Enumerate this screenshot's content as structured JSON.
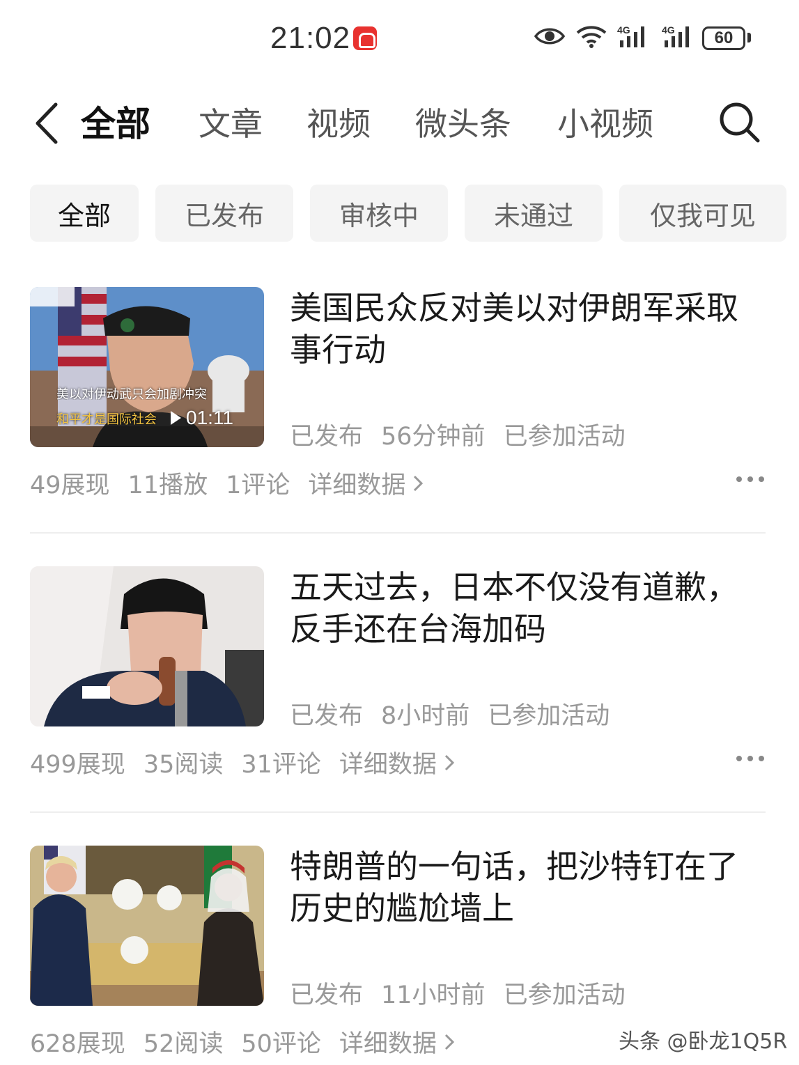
{
  "status_bar": {
    "time": "21:02",
    "network1": "4G",
    "network2": "4G",
    "battery": "60"
  },
  "top_nav": {
    "tabs": [
      {
        "label": "全部",
        "active": true
      },
      {
        "label": "文章",
        "active": false
      },
      {
        "label": "视频",
        "active": false
      },
      {
        "label": "微头条",
        "active": false
      },
      {
        "label": "小视频",
        "active": false
      }
    ]
  },
  "filters": [
    {
      "label": "全部",
      "active": true
    },
    {
      "label": "已发布",
      "active": false
    },
    {
      "label": "审核中",
      "active": false
    },
    {
      "label": "未通过",
      "active": false
    },
    {
      "label": "仅我可见",
      "active": false
    }
  ],
  "items": [
    {
      "title": "美国民众反对美以对伊朗军采取事行动",
      "thumb_caption_line1": "美以对伊动武只会加剧冲突",
      "thumb_caption_line2": "和平才是国际社会",
      "duration": "01:11",
      "meta": [
        "已发布",
        "56分钟前",
        "已参加活动"
      ],
      "stats": [
        "49展现",
        "11播放",
        "1评论"
      ],
      "detail_label": "详细数据"
    },
    {
      "title": "五天过去，日本不仅没有道歉，反手还在台海加码",
      "meta": [
        "已发布",
        "8小时前",
        "已参加活动"
      ],
      "stats": [
        "499展现",
        "35阅读",
        "31评论"
      ],
      "detail_label": "详细数据"
    },
    {
      "title": "特朗普的一句话，把沙特钉在了历史的尴尬墙上",
      "meta": [
        "已发布",
        "11小时前",
        "已参加活动"
      ],
      "stats": [
        "628展现",
        "52阅读",
        "50评论"
      ],
      "detail_label": "详细数据"
    }
  ],
  "watermark": "头条 @卧龙1Q5R",
  "colors": {
    "accent_red": "#e8322f",
    "meta_gray": "#999999",
    "chip_bg": "#f4f4f4"
  }
}
